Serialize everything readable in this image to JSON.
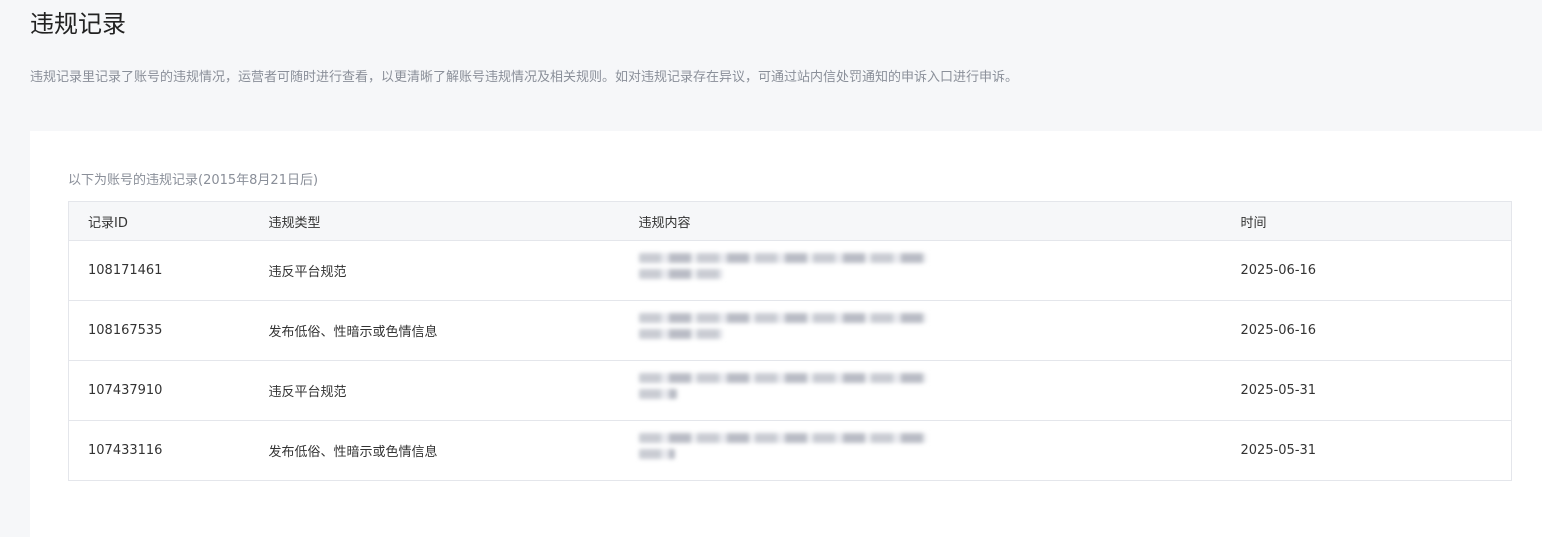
{
  "page": {
    "title": "违规记录",
    "description": "违规记录里记录了账号的违规情况，运营者可随时进行查看，以更清晰了解账号违规情况及相关规则。如对违规记录存在异议，可通过站内信处罚通知的申诉入口进行申诉。"
  },
  "table": {
    "caption": "以下为账号的违规记录(2015年8月21日后)",
    "headers": {
      "id": "记录ID",
      "type": "违规类型",
      "content": "违规内容",
      "time": "时间"
    },
    "rows": [
      {
        "id": "108171461",
        "type": "违反平台规范",
        "time": "2025-06-16"
      },
      {
        "id": "108167535",
        "type": "发布低俗、性暗示或色情信息",
        "time": "2025-06-16"
      },
      {
        "id": "107437910",
        "type": "违反平台规范",
        "time": "2025-05-31"
      },
      {
        "id": "107433116",
        "type": "发布低俗、性暗示或色情信息",
        "time": "2025-05-31"
      }
    ]
  },
  "colors": {
    "background": "#f6f7f9",
    "panel": "#ffffff",
    "link_text": "#576b95",
    "muted_text": "#8a8f99"
  }
}
